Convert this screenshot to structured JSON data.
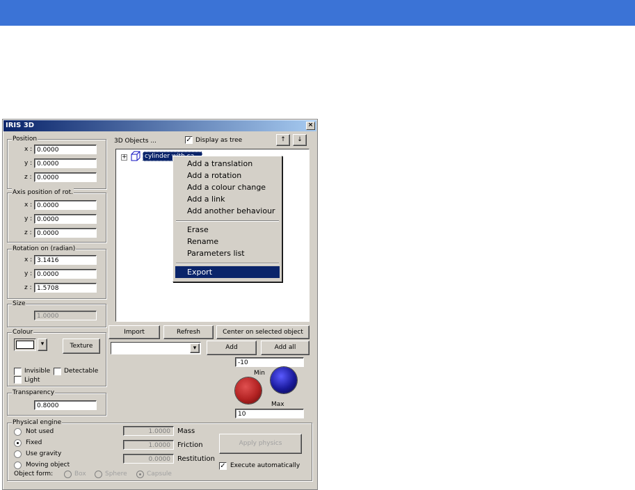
{
  "window": {
    "title": "IRIS 3D",
    "close_glyph": "×"
  },
  "position": {
    "label": "Position",
    "x_label": "x :",
    "y_label": "y :",
    "z_label": "z :",
    "x": "0.0000",
    "y": "0.0000",
    "z": "0.0000"
  },
  "axis": {
    "label": "Axis position of rot.",
    "x_label": "x :",
    "y_label": "y :",
    "z_label": "z :",
    "x": "0.0000",
    "y": "0.0000",
    "z": "0.0000"
  },
  "rotation": {
    "label": "Rotation on (radian)",
    "x_label": "x :",
    "y_label": "y :",
    "z_label": "z :",
    "x": "3.1416",
    "y": "0.0000",
    "z": "1.5708"
  },
  "size": {
    "label": "Size",
    "value": "1.0000"
  },
  "colour": {
    "label": "Colour",
    "texture_button": "Texture",
    "swatch": "#ffffff",
    "dropdown_glyph": "▾"
  },
  "flags": {
    "invisible": "Invisible",
    "detectable": "Detectable",
    "light": "Light"
  },
  "transparency": {
    "label": "Transparency",
    "value": "0.8000"
  },
  "objects": {
    "label": "3D Objects ...",
    "display_tree_label": "Display as tree",
    "display_tree_checked": true,
    "up_glyph": "↑",
    "down_glyph": "↓",
    "expand_glyph": "+",
    "item_label": "cylinder with ca..."
  },
  "context_menu": {
    "group1": [
      "Add a translation",
      "Add a rotation",
      "Add a colour change",
      "Add a link",
      "Add another behaviour"
    ],
    "group2": [
      "Erase",
      "Rename",
      "Parameters list"
    ],
    "group3": [
      "Export"
    ],
    "highlighted": "Export"
  },
  "buttons": {
    "import": "Import",
    "refresh": "Refresh",
    "center": "Center on selected object",
    "add": "Add",
    "add_all": "Add all"
  },
  "range": {
    "min_label": "Min",
    "max_label": "Max",
    "min_value": "-10",
    "max_value": "10"
  },
  "physics": {
    "label": "Physical engine",
    "modes": [
      "Not used",
      "Fixed",
      "Use gravity",
      "Moving object"
    ],
    "selected_mode": "Fixed",
    "object_form_label": "Object form:",
    "forms": [
      "Box",
      "Sphere",
      "Capsule"
    ],
    "selected_form": "Capsule",
    "mass_label": "Mass",
    "mass": "1.0000",
    "friction_label": "Friction",
    "friction": "1.0000",
    "restitution_label": "Restitution",
    "restitution": "0.0000",
    "apply_button": "Apply physics",
    "auto_label": "Execute automatically",
    "auto_checked": true
  },
  "colors": {
    "topbar": "#3b73d6",
    "menu_highlight": "#0a246a",
    "knob_min": "#b22222",
    "knob_max": "#1a1a9c"
  }
}
